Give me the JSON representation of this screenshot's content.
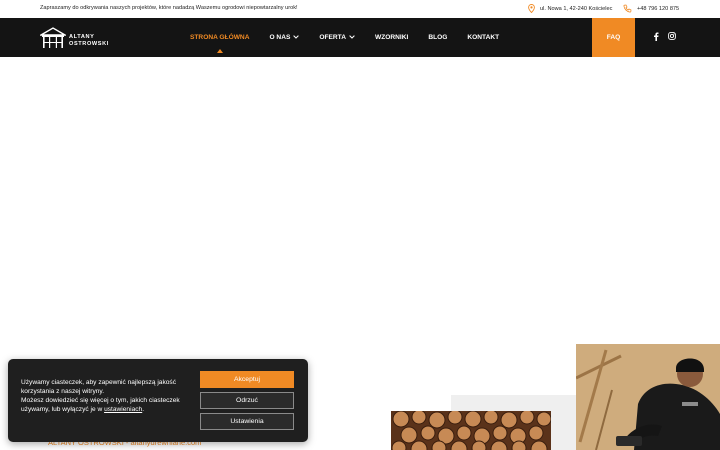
{
  "topbar": {
    "tagline": "Zapraszamy do odkrywania naszych projektów, które nadadzą Waszemu ogrodowi niepowtarzalny urok!",
    "address": "ul. Nowa 1, 42-240 Kościelec",
    "phone": "+48 796 120 875"
  },
  "logo": {
    "line1": "ALTANY",
    "line2": "OSTROWSKI"
  },
  "nav": {
    "items": [
      {
        "label": "STRONA GŁÓWNA",
        "active": true
      },
      {
        "label": "O NAS",
        "dropdown": true
      },
      {
        "label": "OFERTA",
        "dropdown": true
      },
      {
        "label": "WZORNIKI"
      },
      {
        "label": "BLOG"
      },
      {
        "label": "KONTAKT"
      }
    ],
    "faq": "FAQ",
    "social": [
      "facebook-icon",
      "instagram-icon"
    ]
  },
  "content": {
    "link_text": "ALTANY OSTROWSKI - altanydrewniane.com"
  },
  "cookie": {
    "text1": "Używamy ciasteczek, aby zapewnić najlepszą jakość korzystania z naszej witryny.",
    "text2": "Możesz dowiedzieć się więcej o tym, jakich ciasteczek używamy, lub wyłączyć je w",
    "link": "ustawieniach",
    "tail": ".",
    "accept": "Akceptuj",
    "reject": "Odrzuć",
    "settings": "Ustawienia"
  },
  "colors": {
    "accent": "#f08a24",
    "nav_bg": "#141414",
    "cookie_bg": "#1f1f1f"
  }
}
